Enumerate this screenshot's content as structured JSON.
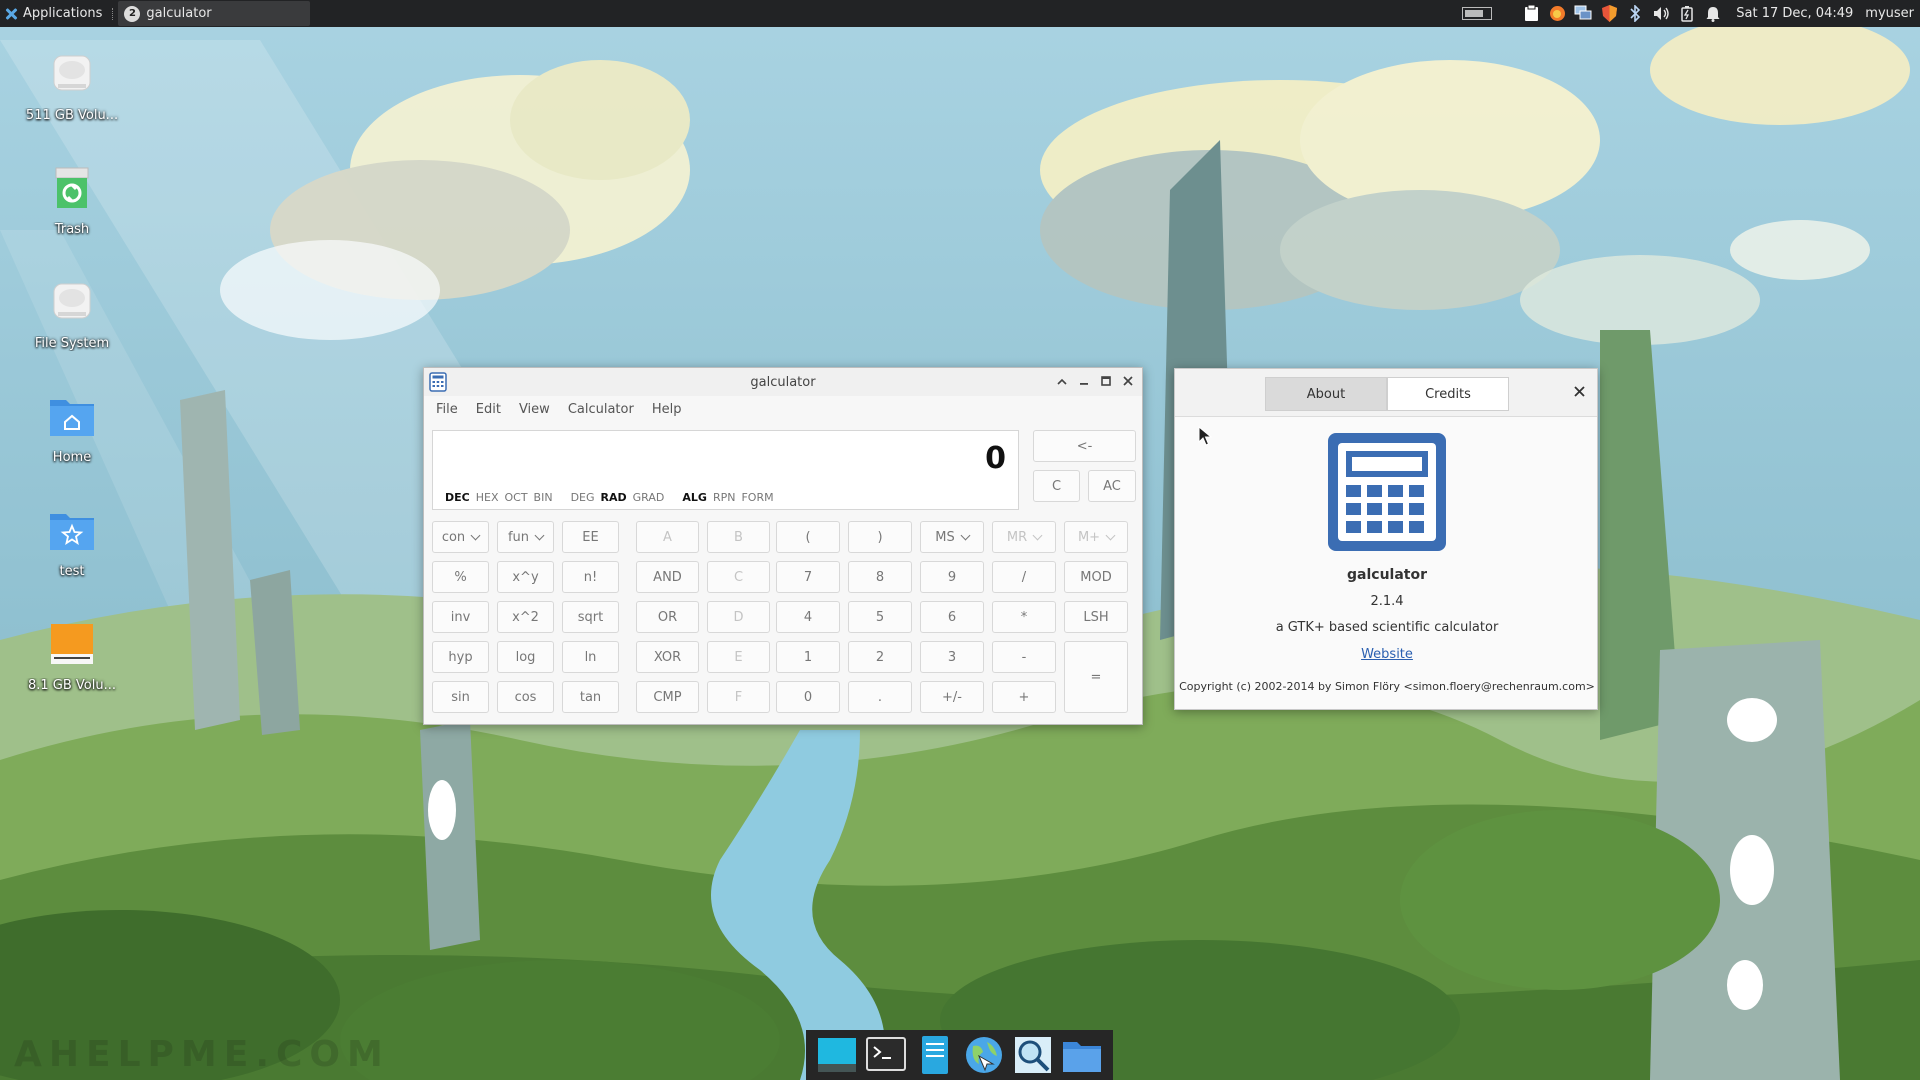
{
  "top_panel": {
    "applications_label": "Applications",
    "task": {
      "badge": "2",
      "title": "galculator"
    },
    "clock": "Sat 17 Dec, 04:49",
    "user": "myuser",
    "tray_icons": [
      "clipboard-icon",
      "firefox-icon",
      "network-icon",
      "shield-icon",
      "bluetooth-icon",
      "volume-icon",
      "battery-icon",
      "bell-icon"
    ]
  },
  "desktop_icons": [
    {
      "label": "511 GB Volu...",
      "icon": "drive-icon"
    },
    {
      "label": "Trash",
      "icon": "trash-icon"
    },
    {
      "label": "File System",
      "icon": "drive-icon"
    },
    {
      "label": "Home",
      "icon": "home-folder-icon"
    },
    {
      "label": "test",
      "icon": "star-folder-icon"
    },
    {
      "label": "8.1 GB Volu...",
      "icon": "usb-drive-icon"
    }
  ],
  "calculator": {
    "title": "galculator",
    "menu": [
      "File",
      "Edit",
      "View",
      "Calculator",
      "Help"
    ],
    "display": {
      "value": "0",
      "number_modes": [
        "DEC",
        "HEX",
        "OCT",
        "BIN"
      ],
      "angle_modes": [
        "DEG",
        "RAD",
        "GRAD"
      ],
      "entry_modes": [
        "ALG",
        "RPN",
        "FORM"
      ],
      "active": [
        "DEC",
        "RAD",
        "ALG"
      ]
    },
    "backspace": "<-",
    "clear": "C",
    "all_clear": "AC",
    "rows": [
      [
        "con",
        "fun",
        "EE",
        "A",
        "B",
        "(",
        ")",
        "MS",
        "MR",
        "M+"
      ],
      [
        "%",
        "x^y",
        "n!",
        "AND",
        "C",
        "7",
        "8",
        "9",
        "/",
        "MOD"
      ],
      [
        "inv",
        "x^2",
        "sqrt",
        "OR",
        "D",
        "4",
        "5",
        "6",
        "*",
        "LSH"
      ],
      [
        "hyp",
        "log",
        "ln",
        "XOR",
        "E",
        "1",
        "2",
        "3",
        "-",
        "="
      ],
      [
        "sin",
        "cos",
        "tan",
        "CMP",
        "F",
        "0",
        ".",
        "+/-",
        "+",
        ""
      ]
    ],
    "disabled": [
      "A",
      "B",
      "C",
      "D",
      "E",
      "F",
      "MR",
      "M+"
    ],
    "dropdowns": [
      "con",
      "fun",
      "MS",
      "MR",
      "M+"
    ]
  },
  "about": {
    "tabs": [
      "About",
      "Credits"
    ],
    "active_tab": "About",
    "name": "galculator",
    "version": "2.1.4",
    "description": "a GTK+ based scientific calculator",
    "website_label": "Website",
    "copyright": "Copyright (c) 2002-2014 by Simon Flöry <simon.floery@rechenraum.com>",
    "accent_color": "#3b6db3"
  },
  "dock_icons": [
    "desktop-icon",
    "terminal-icon",
    "file-manager-icon",
    "web-browser-icon",
    "search-icon",
    "folder-icon"
  ],
  "watermark": "AHELPME.COM"
}
